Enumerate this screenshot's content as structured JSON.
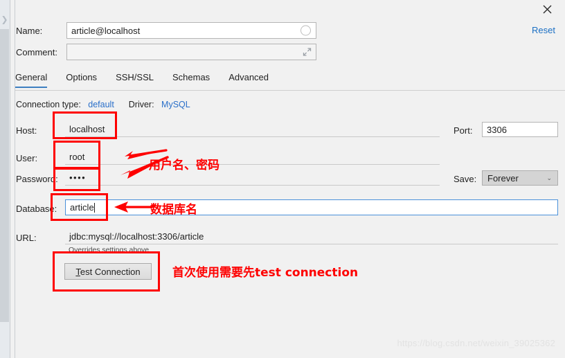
{
  "window": {
    "close_label": "×",
    "reset_label": "Reset",
    "collapse_chevron": "❯"
  },
  "top_fields": {
    "name": {
      "label": "Name:",
      "value": "article@localhost",
      "placeholder": ""
    },
    "comment": {
      "label": "Comment:",
      "value": "",
      "placeholder": ""
    }
  },
  "tabs": [
    {
      "label": "General",
      "active": true
    },
    {
      "label": "Options",
      "active": false
    },
    {
      "label": "SSH/SSL",
      "active": false
    },
    {
      "label": "Schemas",
      "active": false
    },
    {
      "label": "Advanced",
      "active": false
    }
  ],
  "connection_info": {
    "type_label": "Connection type:",
    "type_value": "default",
    "driver_label": "Driver:",
    "driver_value": "MySQL"
  },
  "general": {
    "host": {
      "label": "Host:",
      "value": "localhost"
    },
    "port": {
      "label": "Port:",
      "value": "3306"
    },
    "user": {
      "label": "User:",
      "value": "root"
    },
    "password": {
      "label": "Password:",
      "value": "••••"
    },
    "save": {
      "label": "Save:",
      "value": "Forever",
      "arrow": "⌄"
    },
    "database": {
      "label": "Database:",
      "value": "article"
    },
    "url": {
      "label": "URL:",
      "value": "jdbc:mysql://localhost:3306/article",
      "hint": "Overrides settings above"
    },
    "test_connection": {
      "mnemonic": "T",
      "rest": "est Connection"
    }
  },
  "annotations": {
    "credentials_note": "用户名、密码",
    "database_note": "数据库名",
    "test_note": "首次使用需要先test connection",
    "color": "#fe0000"
  },
  "watermark": {
    "text": "https://blog.csdn.net/weixin_39025362"
  }
}
